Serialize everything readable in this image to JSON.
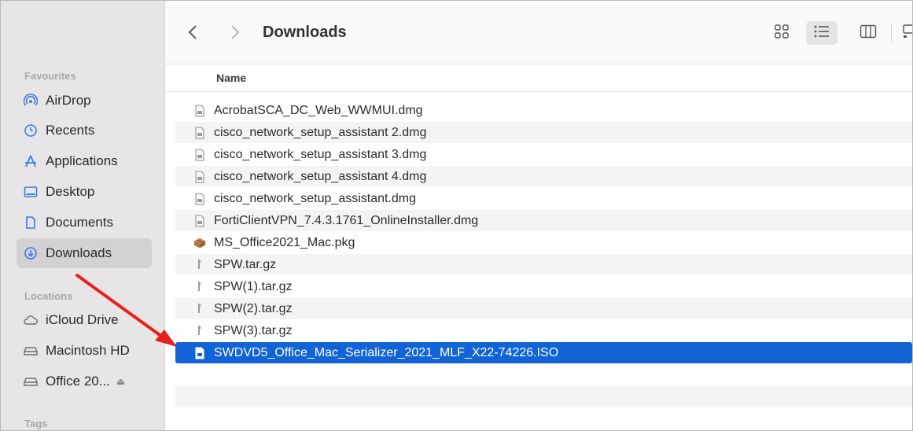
{
  "toolbar": {
    "title": "Downloads"
  },
  "sidebar": {
    "favourites_heading": "Favourites",
    "locations_heading": "Locations",
    "tags_heading": "Tags",
    "favourites": [
      {
        "label": "AirDrop",
        "icon": "airdrop-icon"
      },
      {
        "label": "Recents",
        "icon": "clock-icon"
      },
      {
        "label": "Applications",
        "icon": "applications-icon"
      },
      {
        "label": "Desktop",
        "icon": "desktop-icon"
      },
      {
        "label": "Documents",
        "icon": "document-icon"
      },
      {
        "label": "Downloads",
        "icon": "download-icon",
        "selected": true
      }
    ],
    "locations": [
      {
        "label": "iCloud Drive",
        "icon": "cloud-icon"
      },
      {
        "label": "Macintosh HD",
        "icon": "disk-icon"
      },
      {
        "label": "Office 20...",
        "icon": "disk-icon",
        "eject": "⏏"
      }
    ]
  },
  "list": {
    "column_name": "Name",
    "files": [
      {
        "name": "AcrobatSCA_DC_Web_WWMUI.dmg",
        "icon": "dmg-file-icon"
      },
      {
        "name": "cisco_network_setup_assistant 2.dmg",
        "icon": "dmg-file-icon"
      },
      {
        "name": "cisco_network_setup_assistant 3.dmg",
        "icon": "dmg-file-icon"
      },
      {
        "name": "cisco_network_setup_assistant 4.dmg",
        "icon": "dmg-file-icon"
      },
      {
        "name": "cisco_network_setup_assistant.dmg",
        "icon": "dmg-file-icon"
      },
      {
        "name": "FortiClientVPN_7.4.3.1761_OnlineInstaller.dmg",
        "icon": "dmg-file-icon"
      },
      {
        "name": "MS_Office2021_Mac.pkg",
        "icon": "package-icon"
      },
      {
        "name": "SPW.tar.gz",
        "icon": "archive-file-icon"
      },
      {
        "name": "SPW(1).tar.gz",
        "icon": "archive-file-icon"
      },
      {
        "name": "SPW(2).tar.gz",
        "icon": "archive-file-icon"
      },
      {
        "name": "SPW(3).tar.gz",
        "icon": "archive-file-icon"
      },
      {
        "name": "SWDVD5_Office_Mac_Serializer_2021_MLF_X22-74226.ISO",
        "icon": "iso-file-icon",
        "selected": true
      }
    ]
  },
  "colors": {
    "selection": "#1163d6",
    "annotation_arrow": "#e8201d",
    "sidebar_bg": "#e8e5e6",
    "sidebar_icon": "#3b7be0"
  }
}
